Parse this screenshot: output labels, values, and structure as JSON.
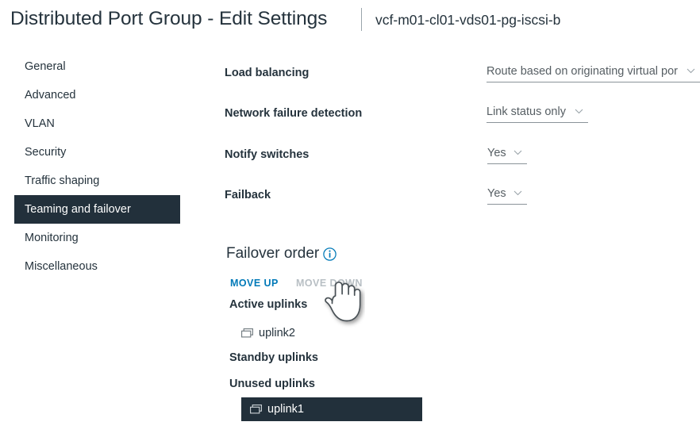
{
  "header": {
    "title": "Distributed Port Group - Edit Settings",
    "separator": "|",
    "object_name": "vcf-m01-cl01-vds01-pg-iscsi-b"
  },
  "sidebar": {
    "items": [
      {
        "label": "General",
        "selected": false
      },
      {
        "label": "Advanced",
        "selected": false
      },
      {
        "label": "VLAN",
        "selected": false
      },
      {
        "label": "Security",
        "selected": false
      },
      {
        "label": "Traffic shaping",
        "selected": false
      },
      {
        "label": "Teaming and failover",
        "selected": true
      },
      {
        "label": "Monitoring",
        "selected": false
      },
      {
        "label": "Miscellaneous",
        "selected": false
      }
    ]
  },
  "form": {
    "fields": [
      {
        "label": "Load balancing",
        "value": "Route based on originating virtual por",
        "control": "dropdown"
      },
      {
        "label": "Network failure detection",
        "value": "Link status only",
        "control": "dropdown"
      },
      {
        "label": "Notify switches",
        "value": "Yes",
        "control": "dropdown"
      },
      {
        "label": "Failback",
        "value": "Yes",
        "control": "dropdown"
      }
    ]
  },
  "failover": {
    "heading": "Failover order",
    "info_icon": "info-circle-icon",
    "move_up_label": "MOVE UP",
    "move_down_label": "MOVE DOWN",
    "move_up_enabled": true,
    "move_down_enabled": false,
    "groups": [
      {
        "title": "Active uplinks",
        "uplinks": [
          {
            "name": "uplink2",
            "icon": "network-adapter-icon",
            "selected": false
          }
        ]
      },
      {
        "title": "Standby uplinks",
        "uplinks": []
      },
      {
        "title": "Unused uplinks",
        "uplinks": [
          {
            "name": "uplink1",
            "icon": "network-adapter-icon",
            "selected": true
          }
        ]
      }
    ]
  },
  "cursor": {
    "type": "pointing-hand-cursor"
  },
  "colors": {
    "accent_link": "#0079b8",
    "selected_bg": "#22303b",
    "text": "#25333d",
    "muted_text": "#565e63",
    "disabled_text": "#b8bfc4",
    "underline": "#8a9399",
    "info_icon": "#0079b8"
  }
}
